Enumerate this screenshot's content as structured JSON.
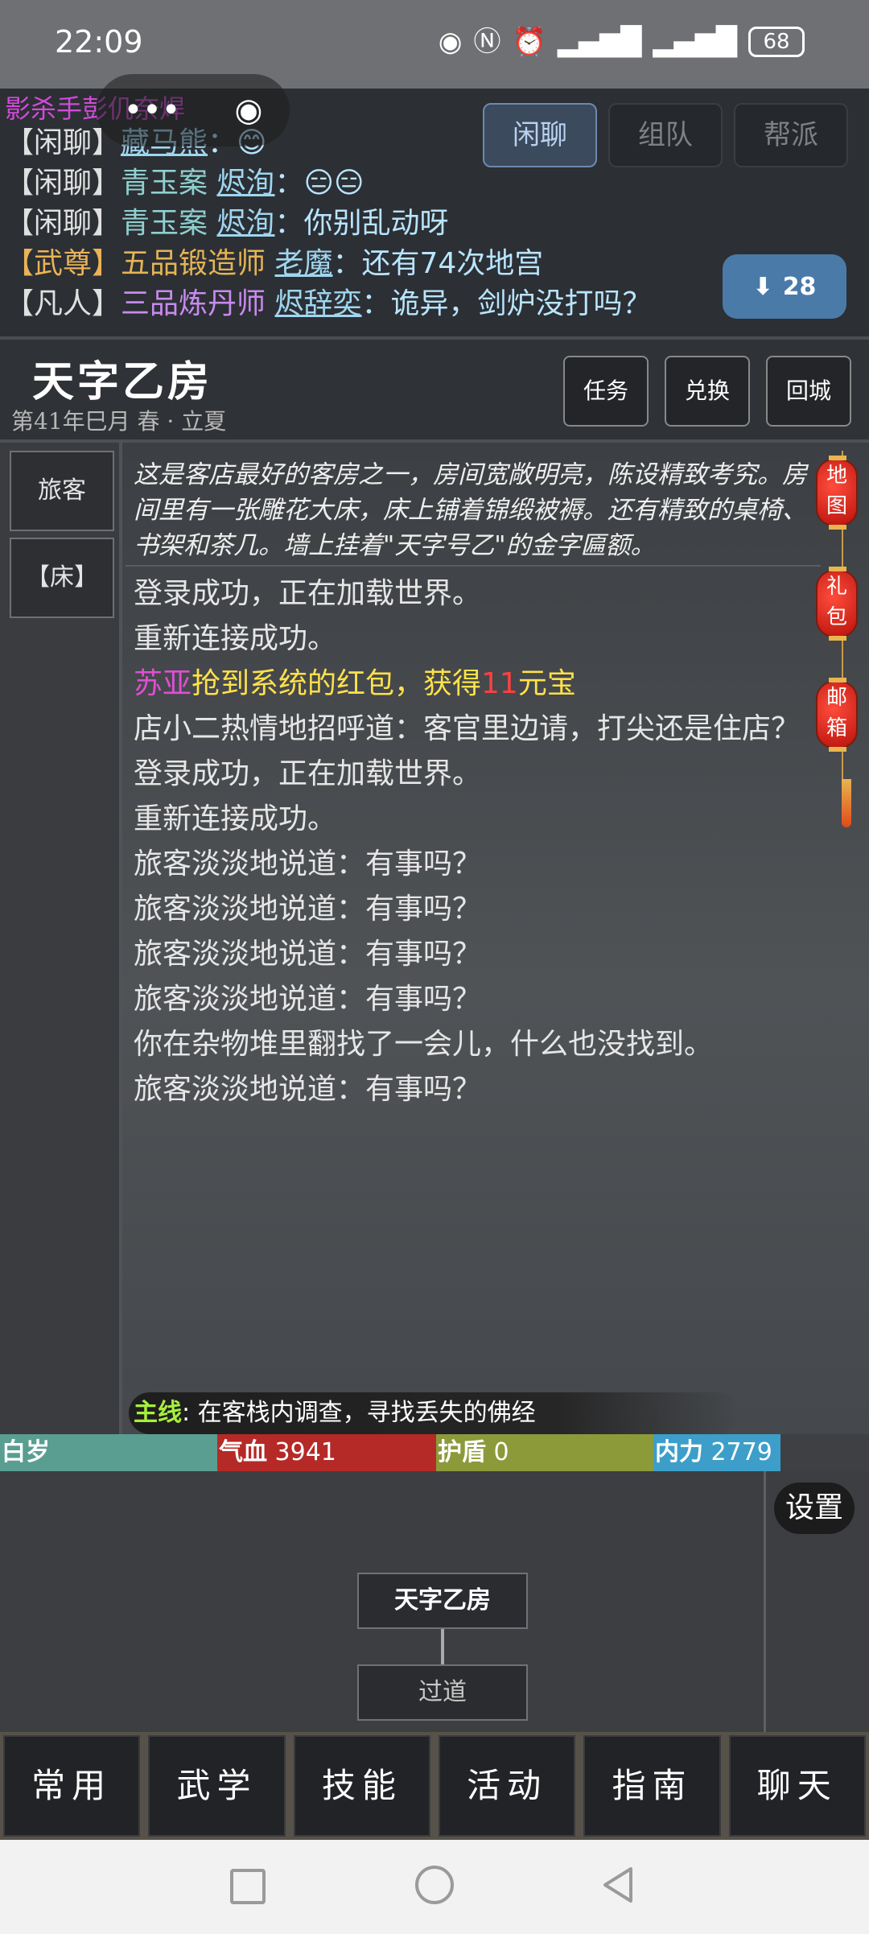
{
  "status_bar": {
    "time": "22:09",
    "battery": "68",
    "icons": [
      "eye-icon",
      "nfc-icon",
      "alarm-icon",
      "signal-icon",
      "signal-icon-2"
    ]
  },
  "chat": {
    "partial_line": "影杀手彭仉奈焊",
    "lines": [
      {
        "tag": "【闲聊】",
        "title": "",
        "name": "藏马熊",
        "text": "：😊"
      },
      {
        "tag": "【闲聊】",
        "title": "青玉案",
        "name": "烬洵",
        "text": "：😑😑"
      },
      {
        "tag": "【闲聊】",
        "title": "青玉案",
        "name": "烬洵",
        "text": "：你别乱动呀"
      },
      {
        "tag": "【武尊】",
        "title": "五品锻造师",
        "name": "老魔",
        "text": "：还有74次地宫"
      },
      {
        "tag": "【凡人】",
        "title": "三品炼丹师",
        "name": "烬辞奕",
        "text": "：诡异，剑炉没打吗？"
      }
    ],
    "tabs": [
      "闲聊",
      "组队",
      "帮派"
    ],
    "active_tab": "闲聊",
    "message_count": "28"
  },
  "location": {
    "title": "天字乙房",
    "date": "第41年巳月  春 · 立夏",
    "buttons": [
      "任务",
      "兑换",
      "回城"
    ]
  },
  "sidebar": {
    "items": [
      "旅客",
      "【床】"
    ]
  },
  "description": "这是客店最好的客房之一，房间宽敞明亮，陈设精致考究。房间里有一张雕花大床，床上铺着锦缎被褥。还有精致的桌椅、书架和茶几。墙上挂着\"天字号乙\"的金字匾额。",
  "log": {
    "l1": "登录成功，正在加载世界。",
    "l2": "重新连接成功。",
    "redpacket_name": "苏亚",
    "redpacket_text": "抢到系统的红包，获得",
    "redpacket_amount": "11",
    "redpacket_unit": "元宝",
    "l4": "店小二热情地招呼道：客官里边请，打尖还是住店？",
    "l5": "登录成功，正在加载世界。",
    "l6": "重新连接成功。",
    "l7": "旅客淡淡地说道：有事吗？",
    "l8": "旅客淡淡地说道：有事吗？",
    "l9": "旅客淡淡地说道：有事吗？",
    "l10": "旅客淡淡地说道：有事吗？",
    "l11": "你在杂物堆里翻找了一会儿，什么也没找到。",
    "l12": "旅客淡淡地说道：有事吗？"
  },
  "quest": {
    "label": "主线",
    "text": ": 在客栈内调查，寻找丢失的佛经"
  },
  "lanterns": [
    "地图",
    "礼包",
    "邮箱"
  ],
  "stats": {
    "age_label": "白岁",
    "hp_label": "气血",
    "hp_value": "3941",
    "shield_label": "护盾",
    "shield_value": "0",
    "mp_label": "内力",
    "mp_value": "2779"
  },
  "map": {
    "settings": "设置",
    "current_room": "天字乙房",
    "adjacent_room": "过道"
  },
  "bottom_nav": [
    "常用",
    "武学",
    "技能",
    "活动",
    "指南",
    "聊天"
  ],
  "colors": {
    "hp": "#b52a26",
    "shield": "#8c9a3a",
    "mp": "#3d9ec9",
    "age": "#5a9e92",
    "accent_tab": "#3b4a5c"
  }
}
